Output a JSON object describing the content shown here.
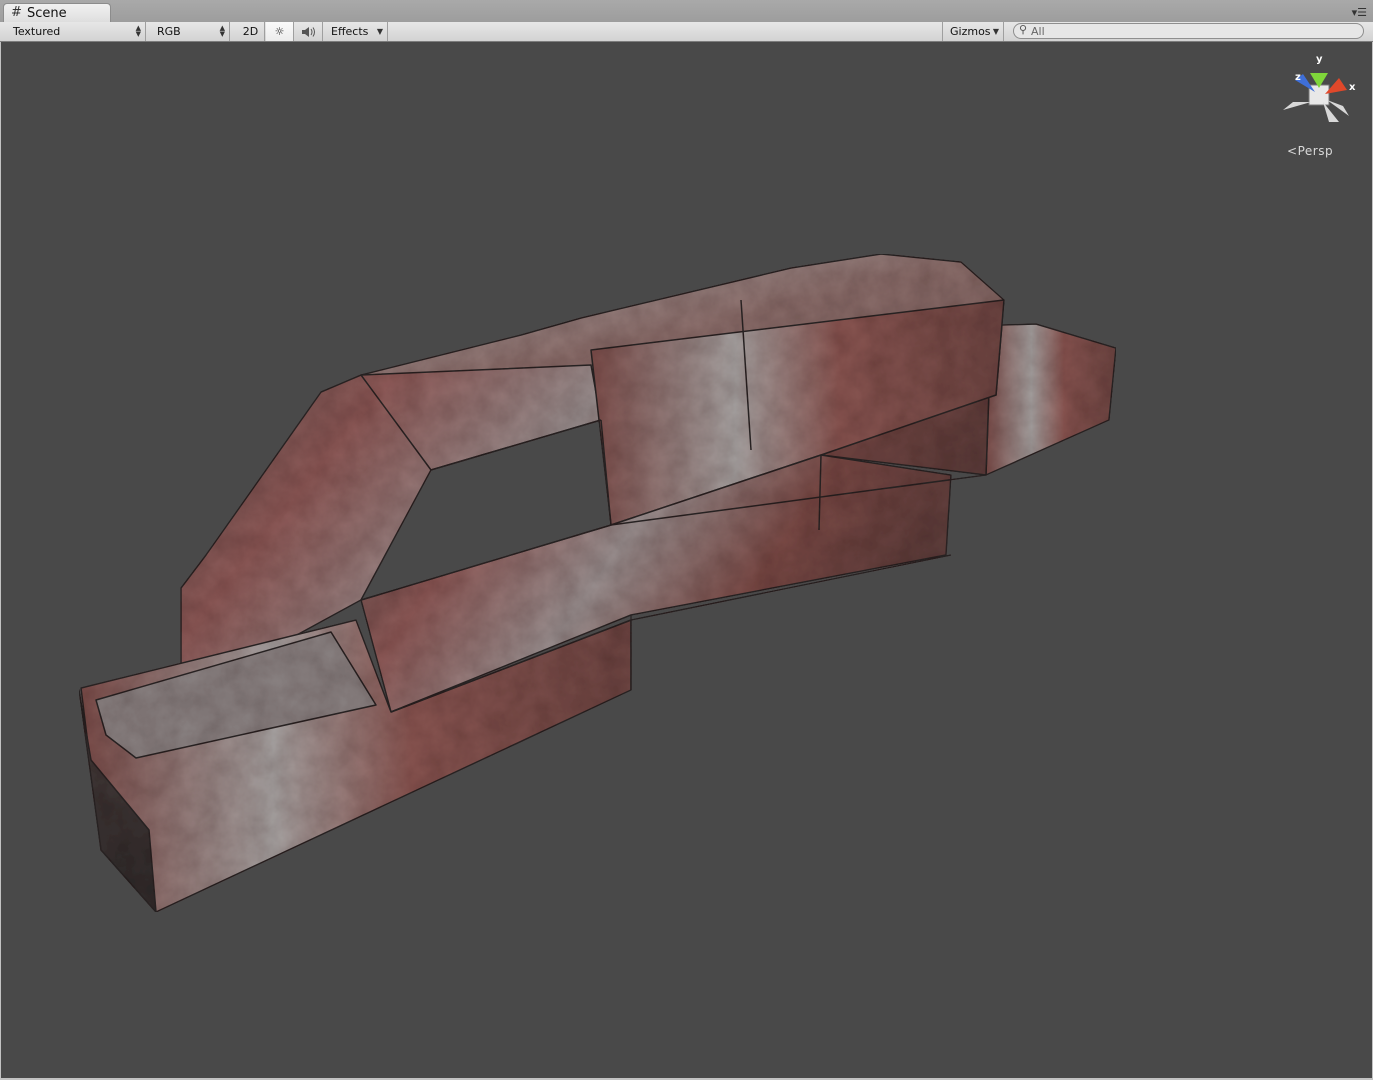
{
  "tab": {
    "label": "Scene",
    "icon": "scene-grid-icon"
  },
  "toolbar": {
    "draw_mode": "Textured",
    "render_mode": "RGB",
    "mode_2d_label": "2D",
    "lighting_icon": "sun-icon",
    "audio_icon": "speaker-icon",
    "effects_label": "Effects",
    "gizmos_label": "Gizmos",
    "search_placeholder": "All"
  },
  "gizmo": {
    "x_label": "x",
    "y_label": "y",
    "z_label": "z",
    "colors": {
      "x": "#e0482a",
      "y": "#7fd63a",
      "z": "#3f6fd8"
    }
  },
  "projection_label": "Persp",
  "colors": {
    "viewport_bg": "#494949",
    "toolbar_bg": "#d8d8d8"
  }
}
